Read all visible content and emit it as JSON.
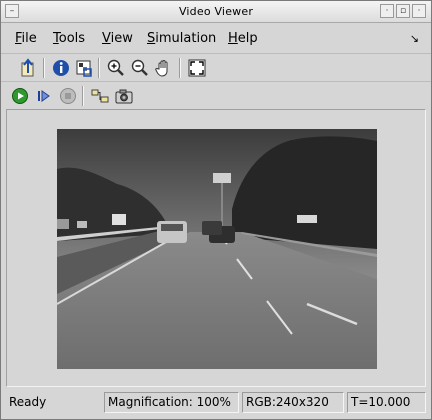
{
  "window": {
    "title": "Video Viewer"
  },
  "menu": {
    "items": [
      {
        "label": "File",
        "mnemonic": "F",
        "rest": "ile"
      },
      {
        "label": "Tools",
        "mnemonic": "T",
        "rest": "ools"
      },
      {
        "label": "View",
        "mnemonic": "V",
        "rest": "iew"
      },
      {
        "label": "Simulation",
        "mnemonic": "S",
        "rest": "imulation"
      },
      {
        "label": "Help",
        "mnemonic": "H",
        "rest": "elp"
      }
    ]
  },
  "toolbar1": {
    "icons": [
      "export-icon",
      "info-icon",
      "pixel-region-icon",
      "zoom-in-icon",
      "zoom-out-icon",
      "pan-hand-icon",
      "fit-to-window-icon"
    ]
  },
  "toolbar2": {
    "icons": [
      "run-icon",
      "step-forward-icon",
      "stop-icon",
      "highlight-signal-icon",
      "snapshot-camera-icon"
    ]
  },
  "status": {
    "state": "Ready",
    "magnification": "Magnification: 100%",
    "format": "RGB:240x320",
    "time": "T=10.000"
  },
  "colors": {
    "background": "#d6d6d6",
    "run_green": "#2e9a2e",
    "info_blue": "#1f4fa8"
  }
}
